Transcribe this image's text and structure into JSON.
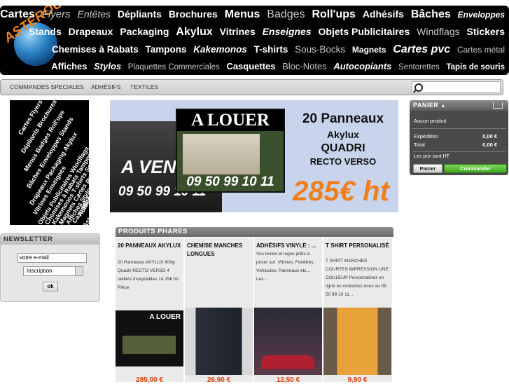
{
  "header": {
    "logo_text": "ASTEROCOM",
    "line1": [
      "Cartes",
      "Flyers",
      "Entêtes",
      "Dépliants",
      "Brochures",
      "Menus",
      "Badges",
      "Roll'ups",
      "Adhésifs",
      "Bâches",
      "Enveloppes"
    ],
    "line2": [
      "Stands",
      "Drapeaux",
      "Packaging",
      "Akylux",
      "Vitrines",
      "Enseignes",
      "Objets Publicitaires",
      "Windflags",
      "Stickers"
    ],
    "line3": [
      "Chemises à Rabats",
      "Tampons",
      "Kakemonos",
      "T-shirts",
      "Sous-Bocks",
      "Magnets",
      "Cartes pvc",
      "Cartes métal"
    ],
    "line4": [
      "Affiches",
      "Stylos",
      "Plaquettes Commerciales",
      "Casquettes",
      "Bloc-Notes",
      "Autocopiants",
      "Sentorettes",
      "Tapis de souris"
    ]
  },
  "nav": {
    "items": [
      "COMMANDES SPECIALES",
      "ADHÉSIFS",
      "TEXTILES"
    ],
    "search_placeholder": ""
  },
  "side_ad": {
    "lines": [
      "Cartes Flyers Entêtes",
      "Dépliants Brochures",
      "Menus Badges Roll'ups",
      "Bâches Enveloppes Stands",
      "Drapeaux Packaging Akylux",
      "Vitrines Enseignes",
      "Objets Publicitaires Windflags",
      "Chemises à Rabats Tampons",
      "Kakemonos T-shirts Sous-Bocks",
      "Magnets Cartes pvc",
      "Affiches Stylos Plaquettes",
      "Casquettes Bloc-Notes",
      "Autocopiants Tapis de souris",
      "06 14 62 46 36"
    ],
    "brand": "Asterocom"
  },
  "newsletter": {
    "title": "NEWSLETTER",
    "email_value": "votre e-mail",
    "select_value": "Inscription",
    "ok_label": "ok"
  },
  "banner": {
    "left_text": "A VEN",
    "left_phone": "09 50 99 10 11",
    "alouer": "A LOUER",
    "phone": "09 50 99 10 11",
    "t1": "20 Panneaux",
    "t2": "Akylux",
    "t3": "QUADRI",
    "t4": "RECTO VERSO",
    "price": "285€ ht"
  },
  "cart": {
    "title": "PANIER",
    "empty": "Aucun produit",
    "shipping_label": "Expédition",
    "shipping_value": "0,00 €",
    "total_label": "Total",
    "total_value": "0,00 €",
    "note": "Les prix sont HT",
    "cart_button": "Panier",
    "order_button": "Commander"
  },
  "products": {
    "title": "PRODUITS PHARES",
    "items": [
      {
        "name": "20 PANNEAUX AKYLUX",
        "desc": "20 Panneaux AKYLUX 600g Quadri RECTO VERSO 4 oeillets inoxydables 14.25€ ht/ Pièce",
        "price": "285,00 €"
      },
      {
        "name": "CHEMISE MANCHES LONGUES",
        "desc": "",
        "price": "26,90 €"
      },
      {
        "name": "ADHÉSIFS VINYLE : ...",
        "desc": "Vos textes et logos prêts à poser sur: Vitrines, Fenêtres, Véhicules, Panneaux etc... Les...",
        "price": "12,50 €"
      },
      {
        "name": "T SHIRT PERSONALISÉ",
        "desc": "T SHIRT MANCHES COURTES IMPRESSION UNE COULEUR Personnalisez en ligne ou contactez-nous au 09 50 99 10 11...",
        "price": "9,90 €"
      }
    ]
  }
}
